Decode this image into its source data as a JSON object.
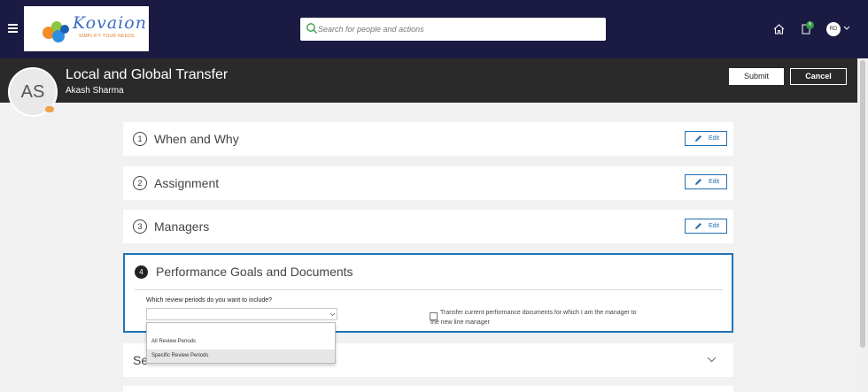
{
  "topbar": {
    "logo_text": "Kovaion",
    "logo_tagline": "SIMPLIFY YOUR NEEDS",
    "search_placeholder": "Search for people and actions",
    "notification_count": "6",
    "user_initials": "RD"
  },
  "header": {
    "avatar_initials": "AS",
    "title": "Local and Global Transfer",
    "subtitle": "Akash Sharma",
    "submit_label": "Submit",
    "cancel_label": "Cancel"
  },
  "sections": [
    {
      "number": "1",
      "title": "When and Why",
      "edit_label": "Edit"
    },
    {
      "number": "2",
      "title": "Assignment",
      "edit_label": "Edit"
    },
    {
      "number": "3",
      "title": "Managers",
      "edit_label": "Edit"
    },
    {
      "number": "4",
      "title": "Performance Goals and Documents"
    },
    {
      "title": "Se"
    }
  ],
  "performance": {
    "question": "Which review periods do you want to include?",
    "select_value": "",
    "checkbox_label": "Transfer current performance documents for which I am the manager to the new line manager",
    "checkbox_checked": false,
    "dropdown_options": [
      "All Review Periods",
      "Specific Review Periods"
    ],
    "highlighted_option": "Specific Review Periods"
  },
  "colors": {
    "topbar": "#1a1a42",
    "header": "#2a2a2a",
    "accent": "#1f6fb2",
    "badge": "#2e9d3f"
  }
}
